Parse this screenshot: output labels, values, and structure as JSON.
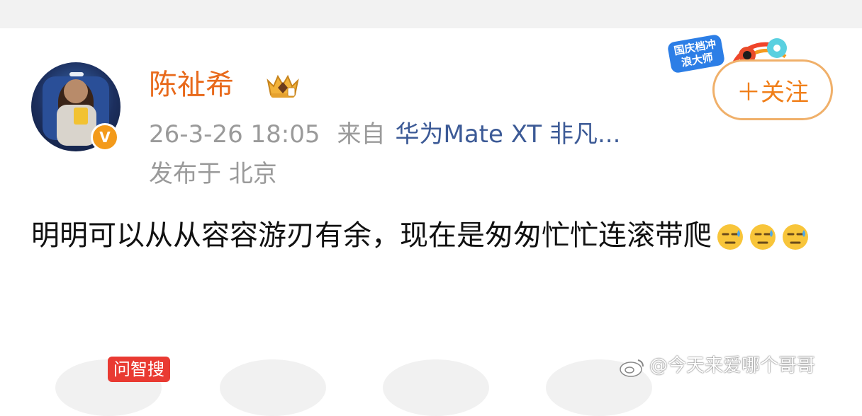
{
  "post": {
    "username": "陈祉希",
    "timestamp": "26-3-26 18:05",
    "from_label": "来自",
    "source": "华为Mate XT 非凡...",
    "location": "发布于 北京",
    "text": "明明可以从从容容游刃有余，现在是匆匆忙忙连滚带爬",
    "emoji_count": 3
  },
  "follow": {
    "label": "＋关注"
  },
  "sticker": {
    "label": "国庆档冲浪大师"
  },
  "ask": {
    "label": "问智搜"
  },
  "watermark": {
    "text": "@今天来爱哪个哥哥"
  },
  "icons": [
    "avatar",
    "verified-badge-icon",
    "crown-level-icon",
    "sweat-emoji-icon",
    "weibo-logo-icon"
  ],
  "colors": {
    "username": "#e86a1c",
    "source": "#3c5a96",
    "meta": "#9a9a9a",
    "follow": "#f07f1a",
    "ask_tag": "#e93a32"
  }
}
